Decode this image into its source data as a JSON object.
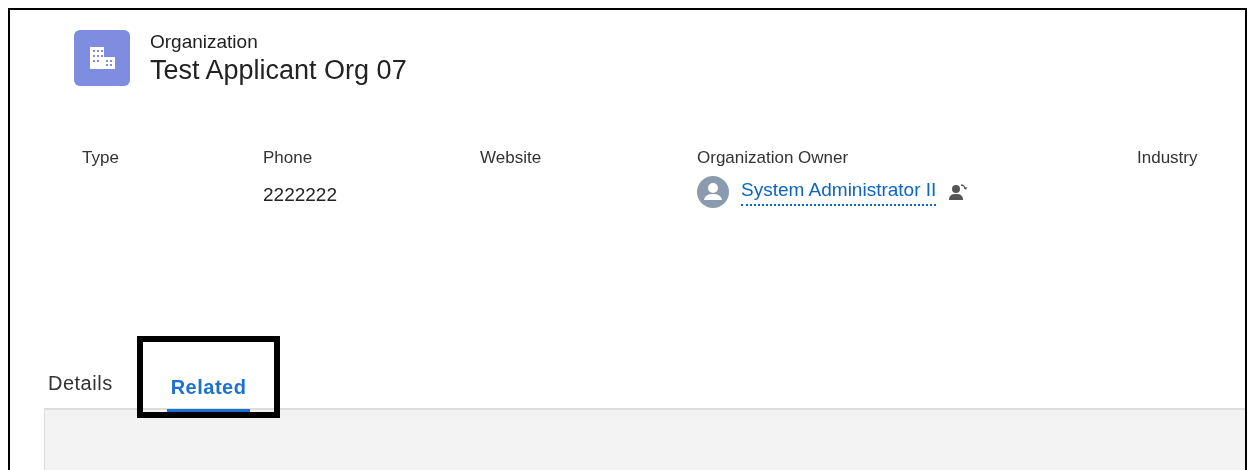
{
  "header": {
    "object_type": "Organization",
    "title": "Test Applicant Org 07"
  },
  "fields": [
    {
      "label": "Type"
    },
    {
      "label": "Phone",
      "value": "2222222"
    },
    {
      "label": "Website"
    },
    {
      "label": "Organization Owner",
      "value": "System Administrator II",
      "kind": "user"
    },
    {
      "label": "Industry"
    }
  ],
  "tabs": [
    {
      "label": "Details",
      "selected": false,
      "highlighted": false
    },
    {
      "label": "Related",
      "selected": true,
      "highlighted": true
    }
  ]
}
